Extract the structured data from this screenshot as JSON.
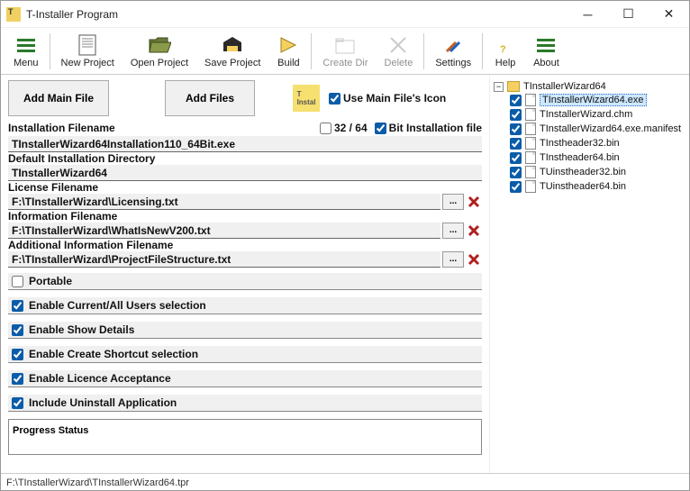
{
  "window": {
    "title": "T-Installer Program"
  },
  "toolbar": {
    "menu": "Menu",
    "new_project": "New Project",
    "open_project": "Open Project",
    "save_project": "Save Project",
    "build": "Build",
    "create_dir": "Create Dir",
    "delete": "Delete",
    "settings": "Settings",
    "help": "Help",
    "about": "About"
  },
  "buttons": {
    "add_main_file": "Add Main File",
    "add_files": "Add Files"
  },
  "icon_options": {
    "use_main_file_icon": "Use Main File's Icon",
    "bits_label": "32 / 64",
    "bit_install_label": "Bit Installation file"
  },
  "fields": {
    "install_filename_label": "Installation Filename",
    "install_filename": "TInstallerWizard64Installation110_64Bit.exe",
    "default_dir_label": "Default Installation Directory",
    "default_dir": "TInstallerWizard64",
    "license_label": "License Filename",
    "license": "F:\\TInstallerWizard\\Licensing.txt",
    "info_label": "Information Filename",
    "info": "F:\\TInstallerWizard\\WhatIsNewV200.txt",
    "addinfo_label": "Additional Information Filename",
    "addinfo": "F:\\TInstallerWizard\\ProjectFileStructure.txt"
  },
  "checkboxes": {
    "portable": "Portable",
    "enable_users": "Enable Current/All Users selection",
    "enable_show_details": "Enable Show Details",
    "enable_shortcut": "Enable Create Shortcut selection",
    "enable_licence": "Enable Licence Acceptance",
    "include_uninstall": "Include Uninstall Application"
  },
  "progress_label": "Progress Status",
  "tree": {
    "root": "TInstallerWizard64",
    "children": [
      {
        "name": "TInstallerWizard64.exe",
        "selected": true
      },
      {
        "name": "TInstallerWizard.chm"
      },
      {
        "name": "TInstallerWizard64.exe.manifest"
      },
      {
        "name": "TInstheader32.bin"
      },
      {
        "name": "TInstheader64.bin"
      },
      {
        "name": "TUinstheader32.bin"
      },
      {
        "name": "TUinstheader64.bin"
      }
    ]
  },
  "statusbar": "F:\\TInstallerWizard\\TInstallerWizard64.tpr"
}
